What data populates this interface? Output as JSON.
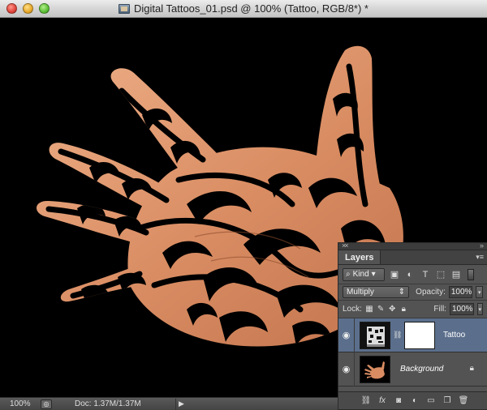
{
  "window": {
    "title": "Digital Tattoos_01.psd @ 100% (Tattoo, RGB/8*) *"
  },
  "status": {
    "zoom": "100%",
    "doc_size": "Doc: 1.37M/1.37M",
    "arrow": "▶"
  },
  "layers_panel": {
    "tab_label": "Layers",
    "filter_kind": "Kind",
    "blend_mode": "Multiply",
    "opacity_label": "Opacity:",
    "opacity_value": "100%",
    "lock_label": "Lock:",
    "fill_label": "Fill:",
    "fill_value": "100%",
    "layers": [
      {
        "name": "Tattoo",
        "selected": true,
        "visible": true
      },
      {
        "name": "Background",
        "selected": false,
        "visible": true,
        "locked": true
      }
    ]
  },
  "colors": {
    "selected_layer": "#5b6f8c",
    "panel_bg": "#535353",
    "canvas_bg": "#000000",
    "skin": "#d9956a"
  }
}
